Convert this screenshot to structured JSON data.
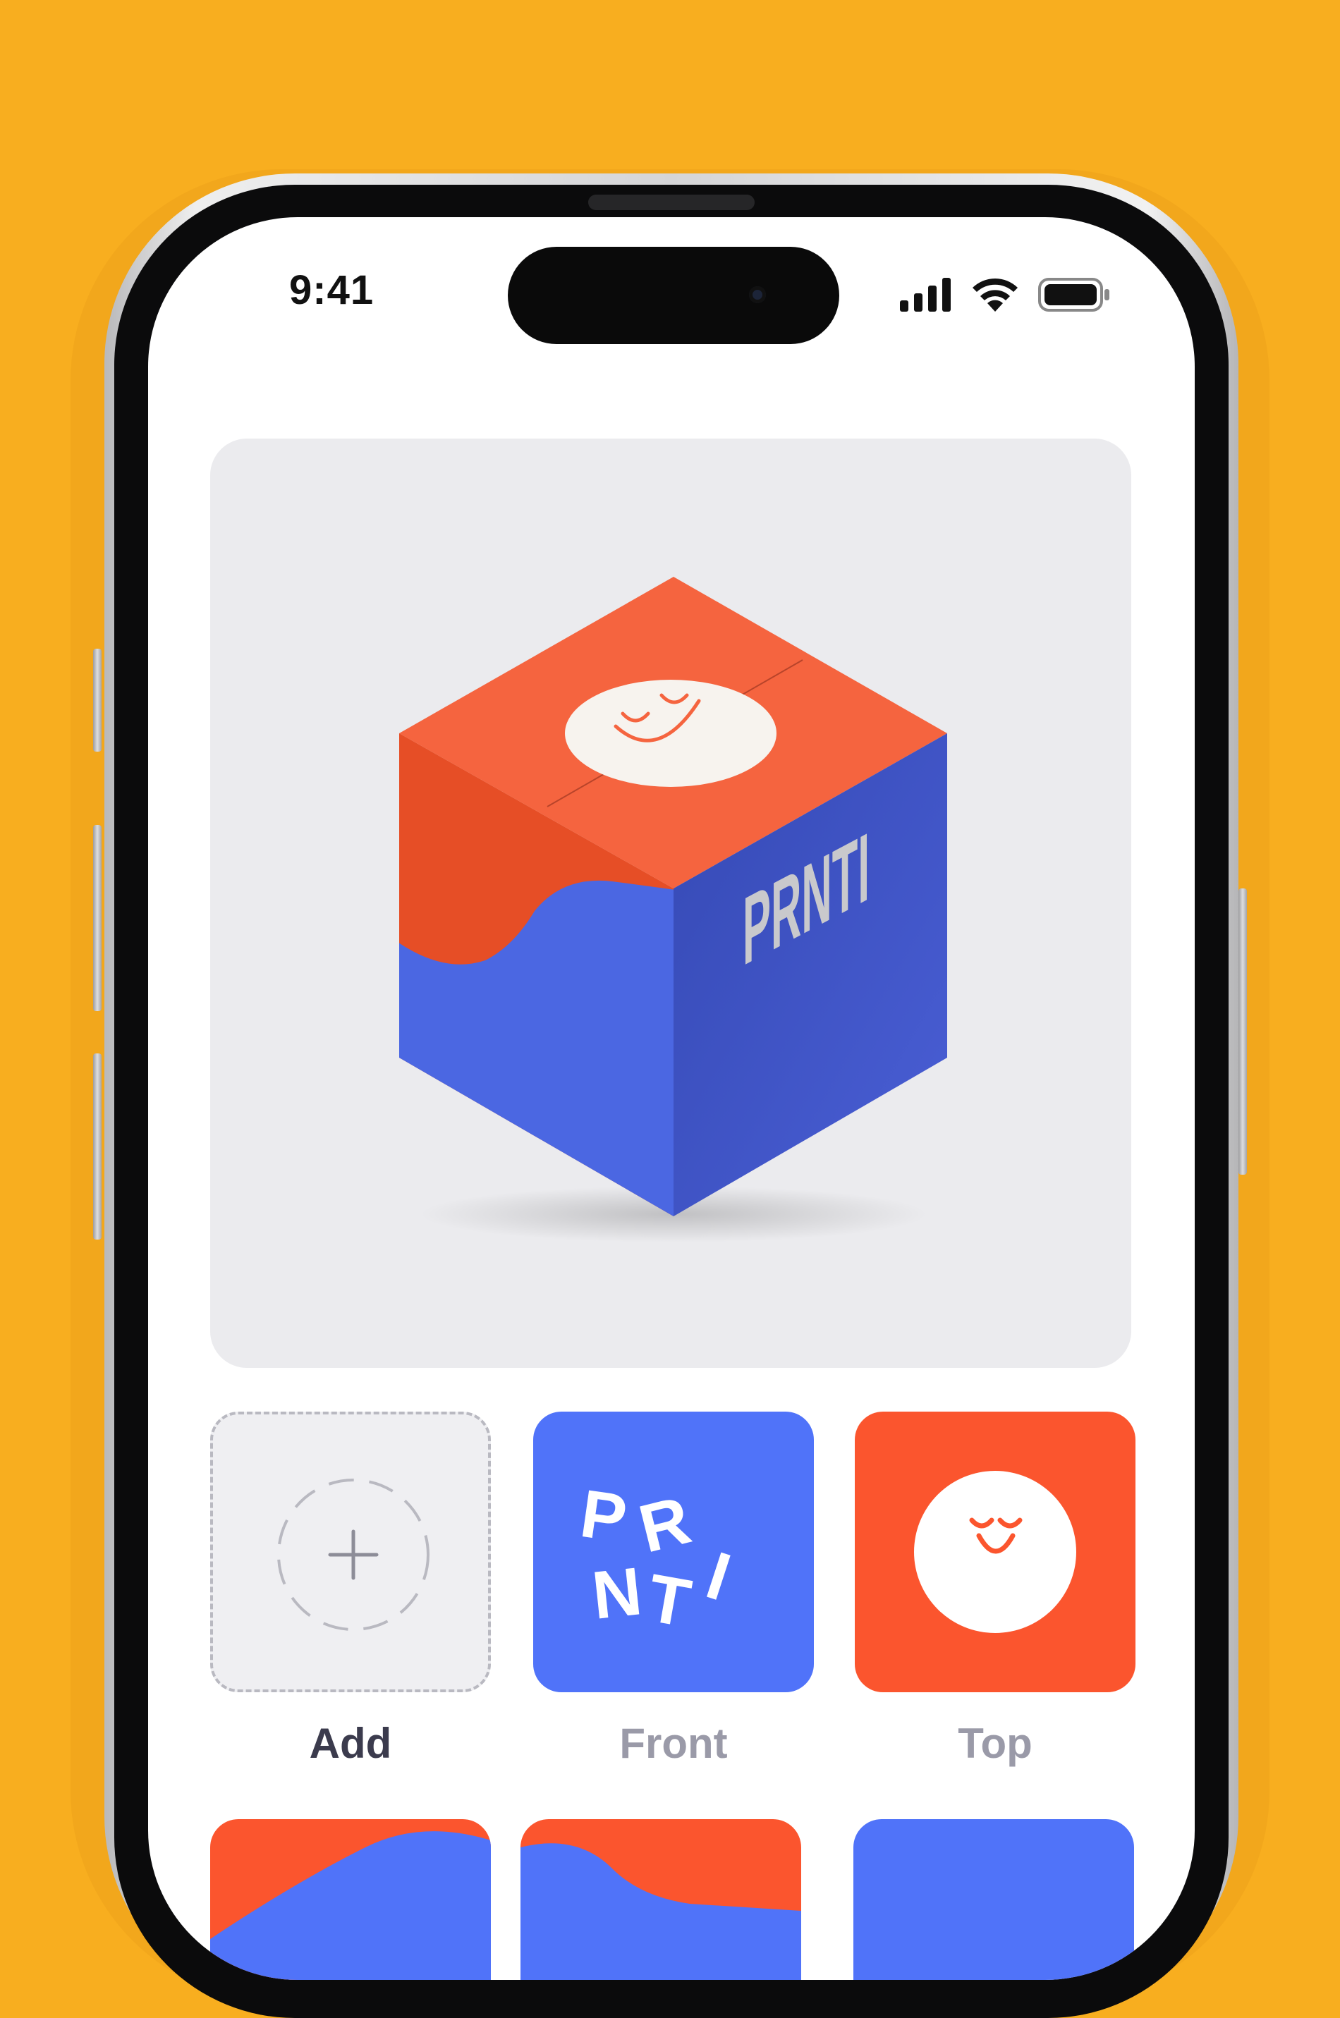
{
  "status_bar": {
    "time": "9:41"
  },
  "icons": {
    "signal": "cellular-signal-icon",
    "wifi": "wifi-icon",
    "battery": "battery-icon",
    "add": "plus-icon"
  },
  "box_preview": {
    "brand_text": "PRNTI"
  },
  "faces": [
    {
      "label": "Add"
    },
    {
      "label": "Front",
      "brand_text": "PRNTI"
    },
    {
      "label": "Top"
    }
  ],
  "colors": {
    "background": "#f8ae1f",
    "brand_blue": "#5073f9",
    "brand_orange": "#fb552e",
    "preview_bg": "#ebebee"
  }
}
